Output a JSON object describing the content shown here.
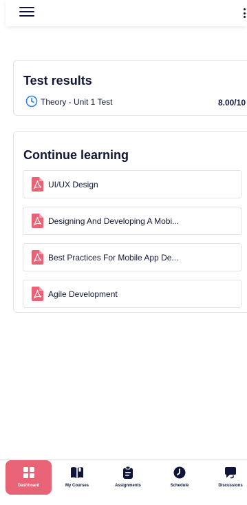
{
  "test_results": {
    "title": "Test results",
    "items": [
      {
        "name": "Theory - Unit 1 Test",
        "score": "8.00/10"
      }
    ]
  },
  "continue_learning": {
    "title": "Continue learning",
    "items": [
      {
        "label": "UI/UX Design",
        "icon": "pdf-icon"
      },
      {
        "label": "Designing And Developing A Mobi...",
        "icon": "pdf-icon"
      },
      {
        "label": "Best Practices For Mobile App De...",
        "icon": "pdf-icon"
      },
      {
        "label": "Agile Development",
        "icon": "pdf-icon"
      }
    ]
  },
  "bottom_nav": {
    "items": [
      {
        "label": "Dashboard",
        "icon": "dashboard-icon",
        "active": true
      },
      {
        "label": "My Courses",
        "icon": "book-icon",
        "active": false
      },
      {
        "label": "Assignments",
        "icon": "clipboard-icon",
        "active": false
      },
      {
        "label": "Schedule",
        "icon": "clock-icon",
        "active": false
      },
      {
        "label": "Discussions",
        "icon": "chat-icon",
        "active": false
      }
    ]
  },
  "colors": {
    "accent": "#e96377",
    "primary_text": "#111636",
    "info_blue": "#2f80ed"
  }
}
